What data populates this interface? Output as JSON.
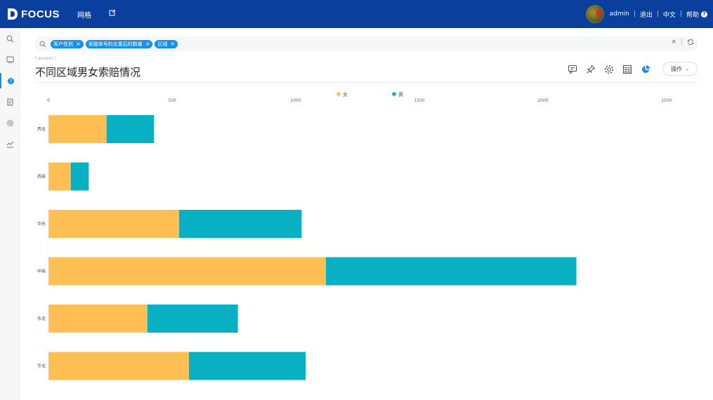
{
  "topbar": {
    "logo_text": "FOCUS",
    "nav_grid": "网格",
    "user": "admin",
    "logout": "退出",
    "language": "中文",
    "help": "帮助",
    "color": "#0b3f9e"
  },
  "sidebar": {
    "icons": [
      "search-icon",
      "board-icon",
      "help-icon",
      "list-icon",
      "gear-icon",
      "trend-icon"
    ]
  },
  "search": {
    "chips": [
      "客户性别",
      "索赔单号的去重后的数量",
      "区域"
    ]
  },
  "hint": "( answer )",
  "page_title": "不同区域男女索赔情况",
  "actions": {
    "op_label": "操作"
  },
  "chart_data": {
    "type": "bar",
    "orientation": "horizontal",
    "stacked": true,
    "categories": [
      "西北",
      "西南",
      "华东",
      "中南",
      "东北",
      "华北"
    ],
    "series": [
      {
        "name": "女",
        "color": "#ffbf55",
        "values": [
          235,
          90,
          528,
          1122,
          400,
          568
        ]
      },
      {
        "name": "男",
        "color": "#07b0c2",
        "values": [
          192,
          73,
          496,
          1013,
          366,
          472
        ]
      }
    ],
    "xlim": [
      0,
      2500
    ],
    "xticks": [
      0,
      500,
      1000,
      1500,
      2000,
      2500
    ],
    "legend": "top-center",
    "grid": false
  }
}
